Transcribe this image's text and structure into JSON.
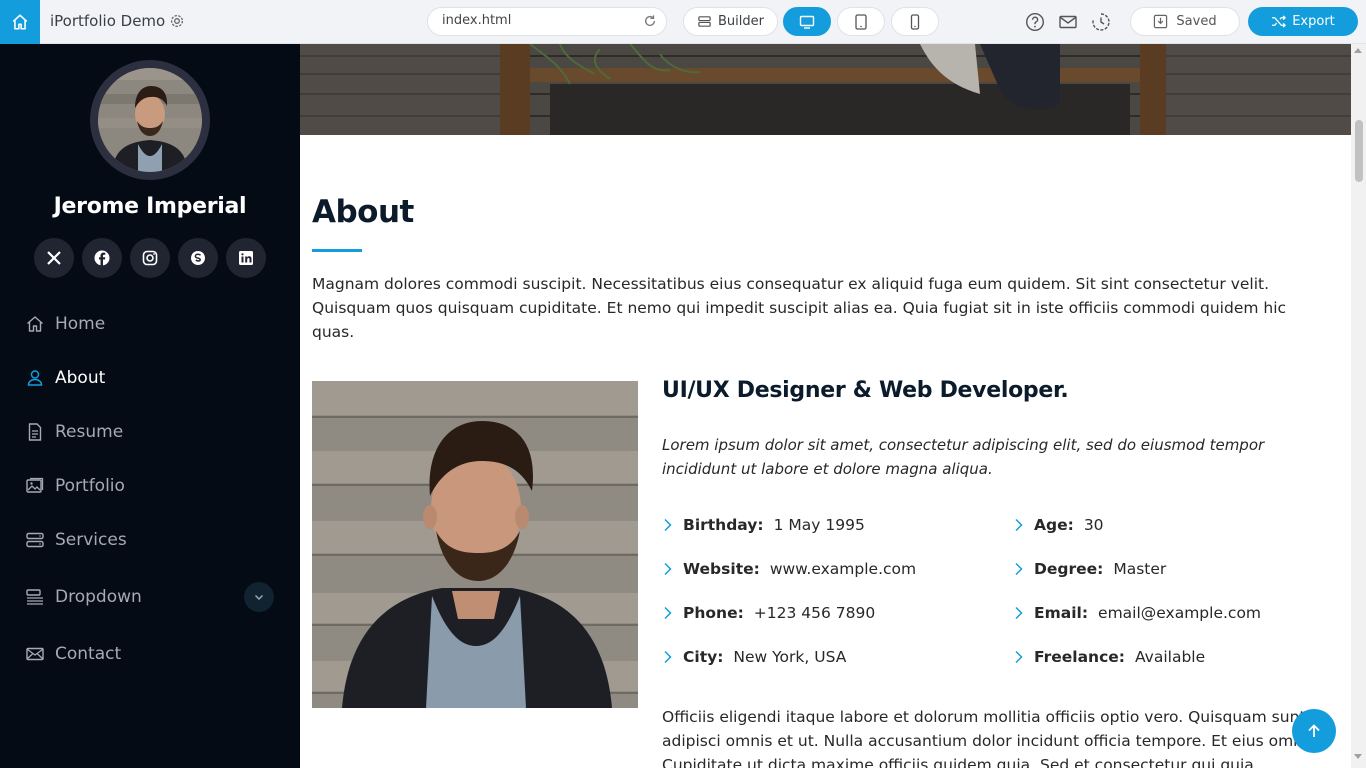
{
  "app": {
    "project_name": "iPortfolio Demo",
    "url": "index.html",
    "builder_label": "Builder",
    "saved_label": "Saved",
    "export_label": "Export",
    "accent": "#149ddd"
  },
  "sidebar": {
    "name": "Jerome Imperial",
    "socials": [
      "x-twitter-icon",
      "facebook-icon",
      "instagram-icon",
      "skype-icon",
      "linkedin-icon"
    ],
    "nav": [
      {
        "label": "Home",
        "icon": "house-icon"
      },
      {
        "label": "About",
        "icon": "person-icon",
        "active": true
      },
      {
        "label": "Resume",
        "icon": "file-text-icon"
      },
      {
        "label": "Portfolio",
        "icon": "images-icon"
      },
      {
        "label": "Services",
        "icon": "hdd-stack-icon"
      },
      {
        "label": "Dropdown",
        "icon": "menu-button-icon"
      },
      {
        "label": "Contact",
        "icon": "envelope-icon"
      }
    ]
  },
  "about": {
    "title": "About",
    "intro": "Magnam dolores commodi suscipit. Necessitatibus eius consequatur ex aliquid fuga eum quidem. Sit sint consectetur velit. Quisquam quos quisquam cupiditate. Et nemo qui impedit suscipit alias ea. Quia fugiat sit in iste officiis commodi quidem hic quas.",
    "role": "UI/UX Designer & Web Developer.",
    "lead": "Lorem ipsum dolor sit amet, consectetur adipiscing elit, sed do eiusmod tempor incididunt ut labore et dolore magna aliqua.",
    "facts_left": [
      {
        "label": "Birthday:",
        "value": "1 May 1995"
      },
      {
        "label": "Website:",
        "value": "www.example.com"
      },
      {
        "label": "Phone:",
        "value": "+123 456 7890"
      },
      {
        "label": "City:",
        "value": "New York, USA"
      }
    ],
    "facts_right": [
      {
        "label": "Age:",
        "value": "30"
      },
      {
        "label": "Degree:",
        "value": "Master"
      },
      {
        "label": "Email:",
        "value": "email@example.com"
      },
      {
        "label": "Freelance:",
        "value": "Available"
      }
    ],
    "paragraph": "Officiis eligendi itaque labore et dolorum mollitia officiis optio vero. Quisquam sunt adipisci omnis et ut. Nulla accusantium dolor incidunt officia tempore. Et eius omnis. Cupiditate ut dicta maxime officiis quidem quia. Sed et consectetur qui quia repellendus itaque neque."
  }
}
